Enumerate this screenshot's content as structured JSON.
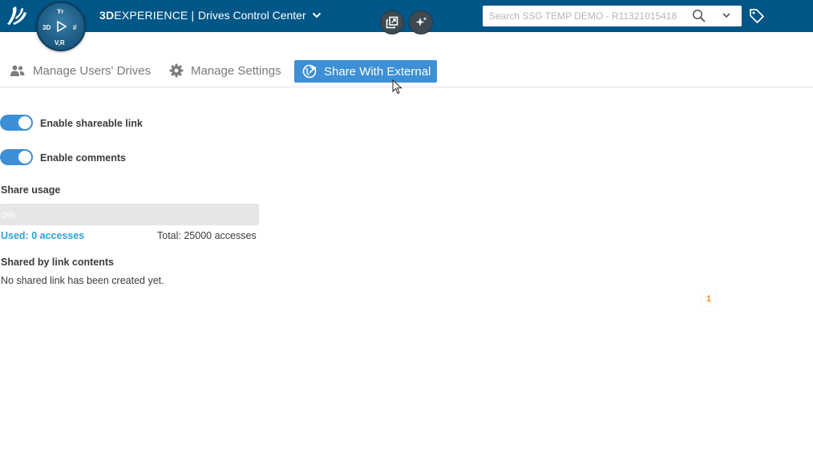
{
  "header": {
    "brand_bold": "3D",
    "brand_rest": "EXPERIENCE",
    "brand_sep": "|",
    "app_title": "Drives Control Center",
    "compass": {
      "top": "Yr",
      "left": "3D",
      "right": "i/",
      "bottom": "V,R"
    },
    "search": {
      "placeholder": "Search SSG TEMP DEMO - R11321015418"
    }
  },
  "tabs": [
    {
      "label": "Manage Users' Drives",
      "icon": "users-icon",
      "active": false
    },
    {
      "label": "Manage Settings",
      "icon": "gear-icon",
      "active": false
    },
    {
      "label": "Share With External",
      "icon": "share-external-icon",
      "active": true
    }
  ],
  "settings": {
    "shareable_link": {
      "label": "Enable shareable link",
      "enabled": true
    },
    "comments": {
      "label": "Enable comments",
      "enabled": true
    }
  },
  "usage": {
    "title": "Share usage",
    "percent_label": "0%",
    "percent": 0,
    "used_label": "Used: 0 accesses",
    "total_label": "Total: 25000 accesses"
  },
  "shared_contents": {
    "title": "Shared by link contents",
    "empty_message": "No shared link has been created yet."
  },
  "pagination": {
    "current": "1"
  },
  "colors": {
    "header": "#005686",
    "accent": "#3d8fd6",
    "used_text": "#2aa3d9",
    "page_number": "#f08a24"
  }
}
